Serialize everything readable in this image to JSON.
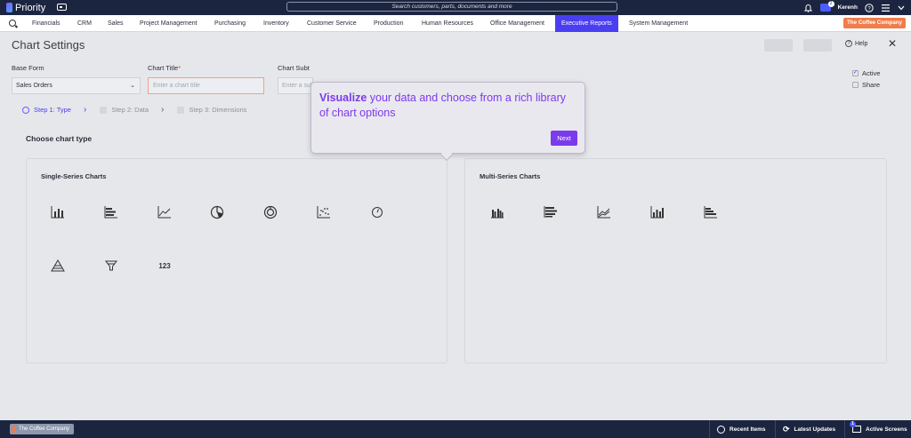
{
  "app": {
    "name": "Priority"
  },
  "search": {
    "placeholder": "Search customers, parts, documents and more"
  },
  "user": {
    "name": "Kerenh",
    "badge": "2"
  },
  "menu": {
    "items": [
      "Financials",
      "CRM",
      "Sales",
      "Project Management",
      "Purchasing",
      "Inventory",
      "Customer Service",
      "Production",
      "Human Resources",
      "Office Management",
      "Executive Reports",
      "System Management"
    ],
    "active": "Executive Reports",
    "company": "The Coffee Company"
  },
  "page": {
    "title": "Chart Settings",
    "help": "Help",
    "close": "✕"
  },
  "form": {
    "base_form_label": "Base Form",
    "base_form_value": "Sales Orders",
    "chart_title_label": "Chart Title",
    "chart_title_placeholder": "Enter a chart title",
    "chart_subtitle_label": "Chart Subt",
    "chart_subtitle_placeholder": "Enter a sub",
    "active_label": "Active",
    "share_label": "Share"
  },
  "steps": [
    {
      "label": "Step 1: Type",
      "state": "active"
    },
    {
      "label": "Step 2: Data",
      "state": "inactive"
    },
    {
      "label": "Step 3: Dimensions",
      "state": "inactive"
    }
  ],
  "chart_type": {
    "heading": "Choose chart type",
    "single_title": "Single-Series Charts",
    "multi_title": "Multi-Series Charts",
    "single_icons": [
      "bar-chart-icon",
      "horizontal-bar-chart-icon",
      "line-chart-icon",
      "pie-chart-icon",
      "donut-chart-icon",
      "scatter-chart-icon",
      "gauge-chart-icon",
      "pyramid-chart-icon",
      "funnel-chart-icon",
      "number-chart-icon"
    ],
    "multi_icons": [
      "grouped-bar-chart-icon",
      "stacked-horizontal-bar-chart-icon",
      "multi-line-chart-icon",
      "stacked-bar-chart-icon",
      "grouped-horizontal-bar-chart-icon"
    ],
    "number_label": "123"
  },
  "popover": {
    "highlight": "Visualize",
    "text": " your data and choose from a rich library of chart options",
    "next": "Next"
  },
  "bottom": {
    "company": "The Coffee Company",
    "recent": "Recent Items",
    "updates": "Latest Updates",
    "screens": "Active Screens",
    "screens_badge": "1"
  }
}
